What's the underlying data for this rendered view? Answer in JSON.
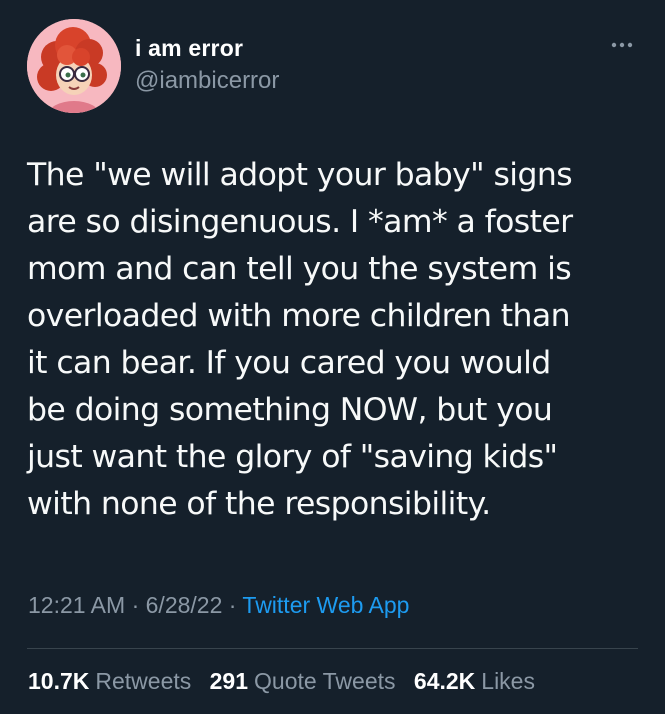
{
  "tweet": {
    "author": {
      "display_name": "i am error",
      "handle": "@iambicerror",
      "avatar_icon": "cartoon-avatar-red-curly-hair-glasses"
    },
    "more_icon": "more-horizontal-icon",
    "text": "The \"we will adopt your baby\" signs\nare so disingenuous. I *am* a foster\nmom and can tell you the system is\noverloaded with more children than\nit can bear. If you cared you would\nbe doing something NOW, but you\njust want the glory of \"saving kids\"\nwith none of the responsibility.",
    "time": "12:21 AM",
    "date": "6/28/22",
    "separator": " · ",
    "source": "Twitter Web App",
    "stats": {
      "retweets_count": "10.7K",
      "retweets_label": "Retweets",
      "quotes_count": "291",
      "quotes_label": "Quote Tweets",
      "likes_count": "64.2K",
      "likes_label": "Likes"
    }
  },
  "colors": {
    "background": "#15202b",
    "primary_text": "#f7f9f9",
    "secondary_text": "#8b98a5",
    "accent": "#1d9bf0",
    "divider": "#38444d",
    "avatar_bg": "#f7b8c0"
  }
}
